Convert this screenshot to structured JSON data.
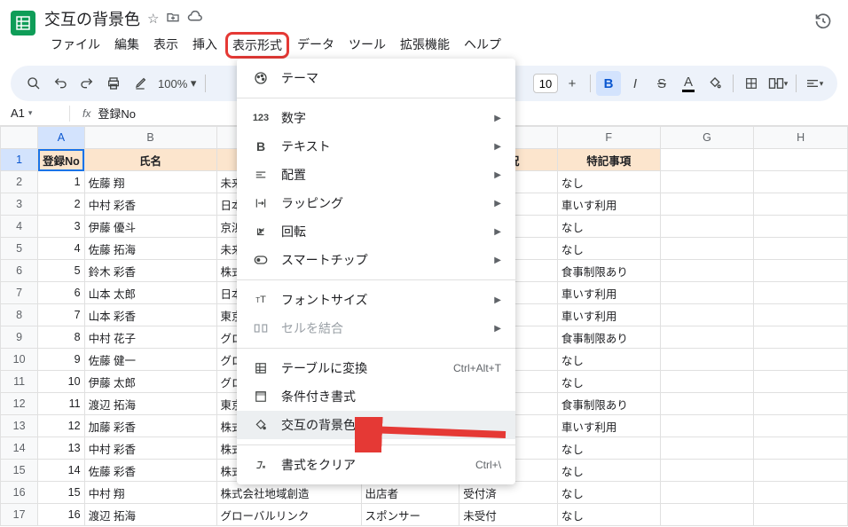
{
  "doc_title": "交互の背景色",
  "menu": {
    "file": "ファイル",
    "edit": "編集",
    "view": "表示",
    "insert": "挿入",
    "format": "表示形式",
    "data": "データ",
    "tools": "ツール",
    "ext": "拡張機能",
    "help": "ヘルプ"
  },
  "toolbar": {
    "zoom": "100%",
    "font_size": "10"
  },
  "namebox": {
    "cell": "A1",
    "formula": "登録No"
  },
  "columns": [
    "A",
    "B",
    "C",
    "D",
    "E",
    "F",
    "G",
    "H"
  ],
  "header_row": {
    "A": "登録No",
    "B": "氏名",
    "C": "",
    "D": "",
    "E": "状況",
    "F": "特記事項"
  },
  "rows": [
    {
      "no": "1",
      "b": "佐藤 翔",
      "c": "未来",
      "f": "なし"
    },
    {
      "no": "2",
      "b": "中村 彩香",
      "c": "日本",
      "f": "車いす利用"
    },
    {
      "no": "3",
      "b": "伊藤 優斗",
      "c": "京浜",
      "f": "なし"
    },
    {
      "no": "4",
      "b": "佐藤 拓海",
      "c": "未来",
      "f": "なし"
    },
    {
      "no": "5",
      "b": "鈴木 彩香",
      "c": "株式",
      "f": "食事制限あり"
    },
    {
      "no": "6",
      "b": "山本 太郎",
      "c": "日本",
      "f": "車いす利用"
    },
    {
      "no": "7",
      "b": "山本 彩香",
      "c": "東京",
      "f": "車いす利用"
    },
    {
      "no": "8",
      "b": "中村 花子",
      "c": "グロ",
      "f": "食事制限あり"
    },
    {
      "no": "9",
      "b": "佐藤 健一",
      "c": "グロ",
      "f": "なし"
    },
    {
      "no": "10",
      "b": "伊藤 太郎",
      "c": "グロ",
      "f": "なし"
    },
    {
      "no": "11",
      "b": "渡辺 拓海",
      "c": "東京",
      "f": "食事制限あり"
    },
    {
      "no": "12",
      "b": "加藤 彩香",
      "c": "株式",
      "f": "車いす利用"
    },
    {
      "no": "13",
      "b": "中村 彩香",
      "c": "株式",
      "f": "なし"
    },
    {
      "no": "14",
      "b": "佐藤 彩香",
      "c": "株式",
      "f": "なし"
    },
    {
      "no": "15",
      "b": "中村 翔",
      "c": "株式会社地域創造",
      "d": "出店者",
      "e": "受付済",
      "f": "なし"
    },
    {
      "no": "16",
      "b": "渡辺 拓海",
      "c": "グローバルリンク",
      "d": "スポンサー",
      "e": "未受付",
      "f": "なし"
    }
  ],
  "dropdown": {
    "theme": "テーマ",
    "number": "数字",
    "text": "テキスト",
    "align": "配置",
    "wrap": "ラッピング",
    "rotate": "回転",
    "smartchip": "スマートチップ",
    "fontsize": "フォントサイズ",
    "merge": "セルを結合",
    "table": "テーブルに変換",
    "table_sc": "Ctrl+Alt+T",
    "cond": "条件付き書式",
    "alt": "交互の背景色",
    "clear": "書式をクリア",
    "clear_sc": "Ctrl+\\"
  }
}
